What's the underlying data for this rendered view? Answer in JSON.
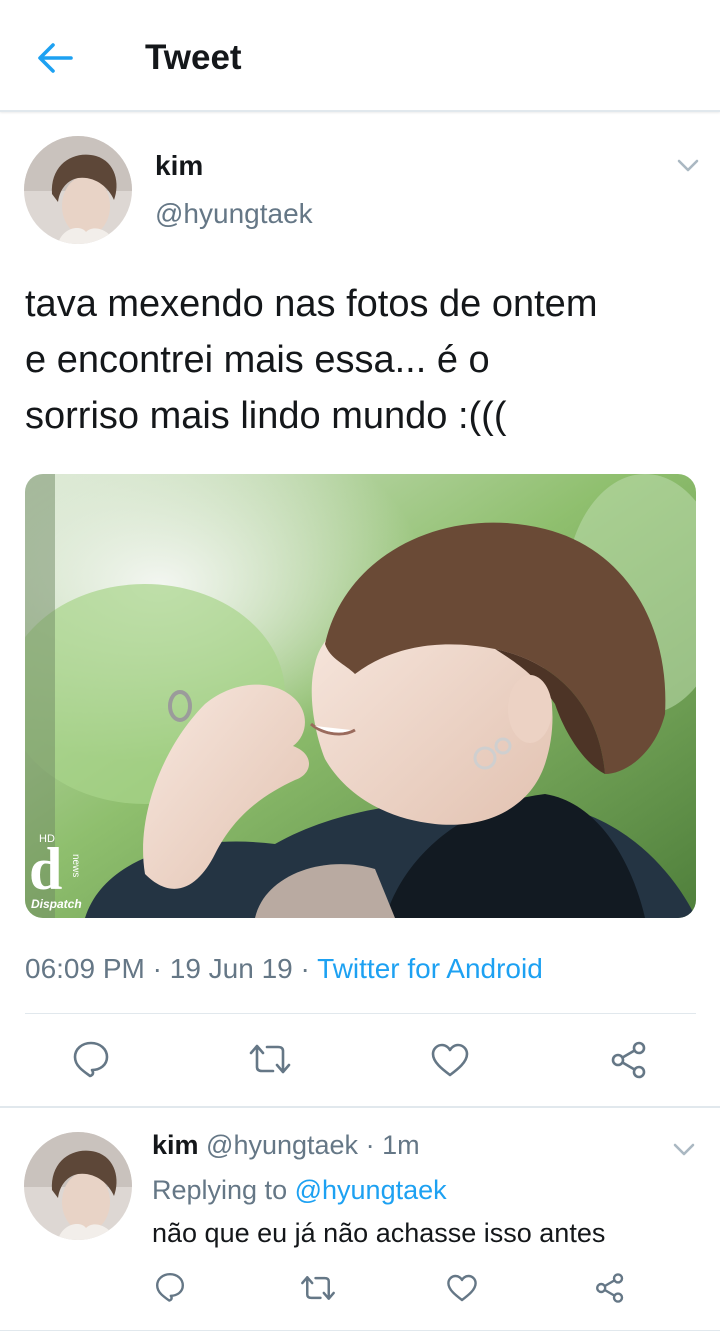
{
  "header": {
    "back_icon": "arrow-left-icon",
    "title": "Tweet"
  },
  "colors": {
    "accent": "#1da1f2",
    "secondary_text": "#657786",
    "divider": "#e1e8ed"
  },
  "tweet": {
    "author_name": "kim",
    "author_handle": "@hyungtaek",
    "text": "tava mexendo nas fotos de ontem\ne encontrei mais essa... é o\nsorriso mais lindo mundo :(((",
    "photo_watermark": {
      "hd": "HD",
      "letter": "d",
      "news": "news",
      "brand": "Dispatch"
    },
    "time": "06:09 PM",
    "date": "19 Jun 19",
    "separator": "·",
    "source": "Twitter for Android",
    "actions": [
      "reply-icon",
      "retweet-icon",
      "like-icon",
      "share-icon"
    ]
  },
  "reply": {
    "author_name": "kim",
    "author_handle": "@hyungtaek",
    "separator": "·",
    "time": "1m",
    "replying_label": "Replying to",
    "replying_to": "@hyungtaek",
    "text": "não que eu já não achasse isso antes",
    "actions": [
      "reply-icon",
      "retweet-icon",
      "like-icon",
      "share-icon"
    ]
  }
}
